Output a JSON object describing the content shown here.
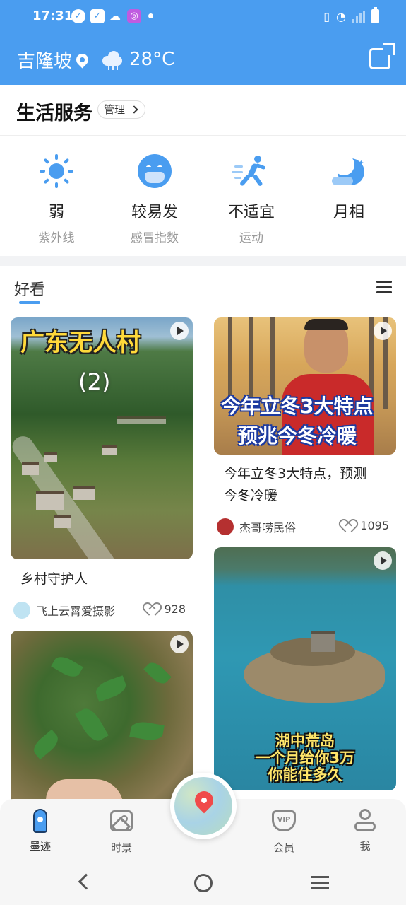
{
  "status_bar": {
    "time": "17:31"
  },
  "header": {
    "city": "吉隆坡",
    "temperature": "28°C",
    "weather_icon": "cloud-rain-icon"
  },
  "life_services": {
    "title": "生活服务",
    "manage_label": "管理",
    "items": [
      {
        "value": "弱",
        "label": "紫外线",
        "icon": "sun-icon"
      },
      {
        "value": "较易发",
        "label": "感冒指数",
        "icon": "mask-face-icon"
      },
      {
        "value": "不适宜",
        "label": "运动",
        "icon": "runner-icon"
      },
      {
        "value": "月相",
        "label": "",
        "icon": "moon-icon"
      }
    ]
  },
  "feed": {
    "tab": "好看",
    "cards": [
      {
        "caption": "广东无人村",
        "caption2": "(2)",
        "title": "乡村守护人",
        "author": "飞上云霄爱摄影",
        "likes": "928"
      },
      {
        "caption": "今年立冬3大特点",
        "caption2": "预兆今冬冷暖",
        "title_line1": "今年立冬3大特点，预测",
        "title_line2": "今冬冷暖",
        "author": "杰哥唠民俗",
        "likes": "1095"
      },
      {
        "caption": ""
      },
      {
        "caption": "湖中荒岛",
        "caption2": "一个月给你3万",
        "caption3": "你能住多久"
      }
    ]
  },
  "bottom_nav": {
    "items": [
      {
        "label": "墨迹"
      },
      {
        "label": "时景"
      },
      {
        "label": "会员"
      },
      {
        "label": "我"
      }
    ],
    "vip_badge": "VIP"
  },
  "colors": {
    "accent": "#4a9df0",
    "text": "#222222",
    "muted": "#999999"
  }
}
